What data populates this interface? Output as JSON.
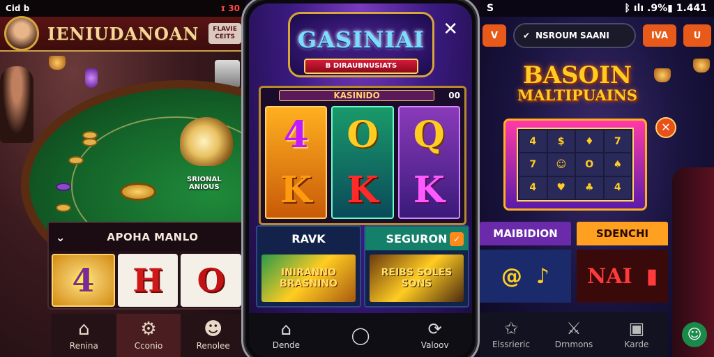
{
  "left_screen": {
    "status_left": "Cid b",
    "status_right": "ɪ 30",
    "title": "IENIUDANOAN",
    "promo_line1": "FLAVIE",
    "promo_line2": "CEITS",
    "felt_line1": "SRIONAL",
    "felt_line2": "ANIOUS",
    "section_label": "APOHA MANLO",
    "tiles": [
      "4",
      "H",
      "O"
    ],
    "nav": [
      {
        "label": "Renina",
        "icon": "home-icon"
      },
      {
        "label": "Cconio",
        "icon": "gear-icon"
      },
      {
        "label": "Renolee",
        "icon": "mascot-icon"
      }
    ]
  },
  "center_screen": {
    "logo_title": "GASINIAI",
    "logo_subtitle": "B DIRAUBNUSIATS",
    "slot_label": "KASINIDO",
    "slot_counter": "00",
    "reels": [
      [
        "4",
        "K"
      ],
      [
        "O",
        "K"
      ],
      [
        "Q",
        "K"
      ]
    ],
    "cards": [
      {
        "title": "RAVK",
        "art": "INIRANNO BRASNINO"
      },
      {
        "title": "SEGURON",
        "art": "REIBS SOLES SONS"
      }
    ],
    "nav": [
      {
        "label": "Dende",
        "icon": "home-icon"
      },
      {
        "label": "",
        "icon": "circle-icon"
      },
      {
        "label": "Valoov",
        "icon": "refresh-icon"
      }
    ]
  },
  "right_screen": {
    "status_right": "ᛒ ılı .9%▮ 1.441",
    "btn_left": "V",
    "search_text": "NSROUM SAANI",
    "btn_mid": "IVA",
    "btn_right": "U",
    "heading_line1": "BASOIN",
    "heading_line2": "MALTIPUAINS",
    "machine_symbols": [
      "4",
      "$",
      "♦",
      "7",
      "7",
      "☺",
      "O",
      "♠",
      "4",
      "♥",
      "♣",
      "4"
    ],
    "cards": [
      {
        "title": "MAIBIDION",
        "art": [
          "@",
          "♪"
        ]
      },
      {
        "title": "SDENCHI",
        "art": [
          "NAI",
          "▮"
        ]
      }
    ],
    "nav": [
      {
        "label": "Elssrieric",
        "icon": "star-icon"
      },
      {
        "label": "Drnmons",
        "icon": "crossed-swords-icon"
      },
      {
        "label": "Karde",
        "icon": "box-icon"
      }
    ]
  }
}
